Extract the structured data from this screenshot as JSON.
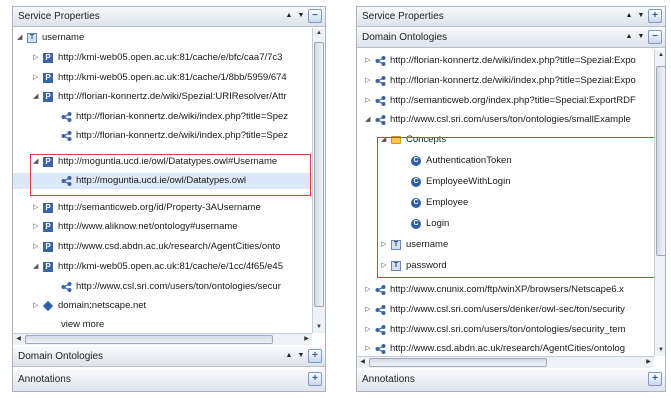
{
  "left": {
    "header_title": "Service Properties",
    "domain_title": "Domain Ontologies",
    "annotations_title": "Annotations",
    "rows": [
      {
        "icon": "t",
        "text": "username",
        "expanded": true
      },
      {
        "icon": "p",
        "text": "http://kmi-web05.open.ac.uk:81/cache/e/bfc/caa7/7c3"
      },
      {
        "icon": "p",
        "text": "http://kmi-web05.open.ac.uk:81/cache/1/8bb/5959/674"
      },
      {
        "icon": "p",
        "text": "http://florian-konnertz.de/wiki/Spezial:URIResolver/Attr",
        "expanded": true
      },
      {
        "icon": "l",
        "text": "http://florian-konnertz.de/wiki/index.php?title=Spez"
      },
      {
        "icon": "l",
        "text": "http://florian-konnertz.de/wiki/index.php?title=Spez"
      },
      {
        "icon": "p",
        "text": "http://moguntia.ucd.ie/owl/Datatypes.owl#Username",
        "expanded": true
      },
      {
        "icon": "l",
        "text": "http://moguntia.ucd.ie/owl/Datatypes.owl"
      },
      {
        "icon": "p",
        "text": "http://semanticweb.org/id/Property-3AUsername"
      },
      {
        "icon": "p",
        "text": "http://www.aliknow.net/ontology#username"
      },
      {
        "icon": "p",
        "text": "http://www.csd.abdn.ac.uk/research/AgentCities/onto"
      },
      {
        "icon": "p",
        "text": "http://kmi-web05.open.ac.uk:81/cache/e/1cc/4f65/e45",
        "expanded": true
      },
      {
        "icon": "l",
        "text": "http://www.csl.sri.com/users/ton/ontologies/secur"
      },
      {
        "icon": "d",
        "text": "domain:netscape.net"
      },
      {
        "icon": "",
        "text": "view more"
      }
    ]
  },
  "right": {
    "header_title": "Service Properties",
    "domain_title": "Domain Ontologies",
    "annotations_title": "Annotations",
    "rows": [
      {
        "icon": "l",
        "text": "http://florian-konnertz.de/wiki/index.php?title=Spezial:Expo"
      },
      {
        "icon": "l",
        "text": "http://florian-konnertz.de/wiki/index.php?title=Spezial:Expo"
      },
      {
        "icon": "l",
        "text": "http://semanticweb.org/index.php?title=Special:ExportRDF"
      },
      {
        "icon": "l",
        "text": "http://www.csl.sri.com/users/ton/ontologies/smallExample",
        "expanded": true
      },
      {
        "icon": "f",
        "text": "Concepts",
        "expanded": true
      },
      {
        "icon": "c",
        "text": "AuthenticationToken"
      },
      {
        "icon": "c",
        "text": "EmployeeWithLogin"
      },
      {
        "icon": "c",
        "text": "Employee"
      },
      {
        "icon": "c",
        "text": "Login"
      },
      {
        "icon": "t",
        "text": "username"
      },
      {
        "icon": "t",
        "text": "password"
      },
      {
        "icon": "l",
        "text": "http://www.cnunix.com/ftp/winXP/browsers/Netscape6.x"
      },
      {
        "icon": "l",
        "text": "http://www.csl.sri.com/users/denker/owl-sec/ton/security"
      },
      {
        "icon": "l",
        "text": "http://www.csl.sri.com/users/ton/ontologies/security_tem"
      },
      {
        "icon": "l",
        "text": "http://www.csd.abdn.ac.uk/research/AgentCities/ontolog"
      }
    ]
  },
  "icons": {
    "p": "property-icon",
    "t": "datatype-icon",
    "l": "link-icon",
    "c": "concept-icon",
    "f": "folder-icon",
    "d": "domain-icon"
  },
  "colors": {
    "highlight_border": "#e23b3b",
    "panel_border": "#a9b3c2",
    "accent_blue": "#2f5ea8"
  }
}
